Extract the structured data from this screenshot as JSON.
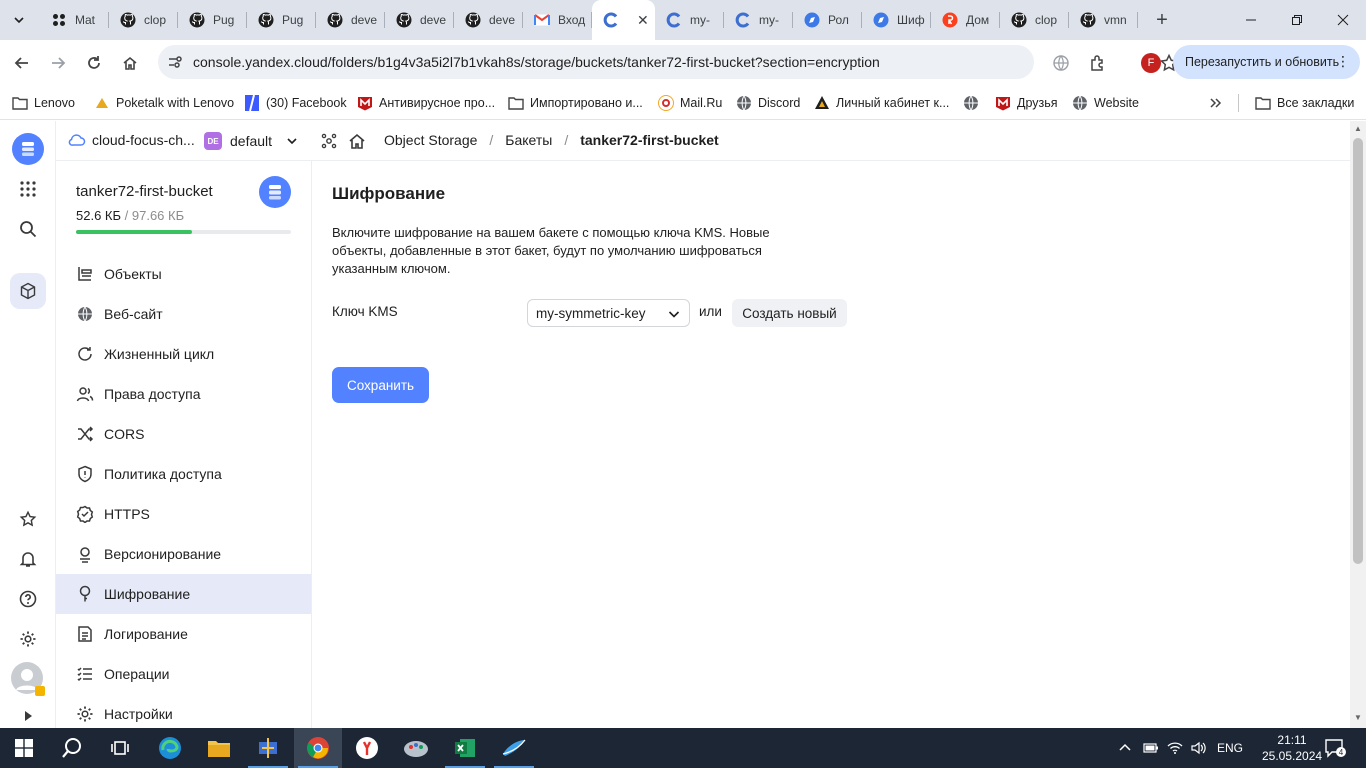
{
  "browser": {
    "tabs": [
      {
        "title": "Mat",
        "icon": "waffle-icon"
      },
      {
        "title": "clop",
        "icon": "github-icon"
      },
      {
        "title": "Pug",
        "icon": "github-icon"
      },
      {
        "title": "Pug",
        "icon": "github-icon"
      },
      {
        "title": "deve",
        "icon": "github-icon"
      },
      {
        "title": "deve",
        "icon": "github-icon"
      },
      {
        "title": "deve",
        "icon": "github-icon"
      },
      {
        "title": "Вход",
        "icon": "gmail-icon"
      },
      {
        "title": "",
        "icon": "yandex-cloud-icon",
        "active": true
      },
      {
        "title": "my-",
        "icon": "yandex-cloud-icon"
      },
      {
        "title": "my-",
        "icon": "yandex-cloud-icon"
      },
      {
        "title": "Рол",
        "icon": "compass-icon"
      },
      {
        "title": "Шиф",
        "icon": "compass-icon"
      },
      {
        "title": "Дом",
        "icon": "yandex-icon"
      },
      {
        "title": "clop",
        "icon": "github-icon"
      },
      {
        "title": "vmn",
        "icon": "github-icon"
      }
    ],
    "url": "console.yandex.cloud/folders/b1g4v3a5i2l7b1vkah8s/storage/buckets/tanker72-first-bucket?section=encryption",
    "relaunch_label": "Перезапустить и обновить",
    "profile_initial": "F",
    "bookmarks": [
      {
        "label": "Lenovo",
        "icon": "folder-icon"
      },
      {
        "label": "Poketalk with Lenovo",
        "icon": "poketalk-icon"
      },
      {
        "label": "(30) Facebook",
        "icon": "facebook-icon"
      },
      {
        "label": "Антивирусное про...",
        "icon": "mcafee-icon"
      },
      {
        "label": "Импортировано и...",
        "icon": "folder-icon"
      },
      {
        "label": "Mail.Ru",
        "icon": "mailru-icon"
      },
      {
        "label": "Discord",
        "icon": "globe-icon"
      },
      {
        "label": "Личный кабинет к...",
        "icon": "cabinet-icon"
      },
      {
        "label": "",
        "icon": "globe-icon"
      },
      {
        "label": "Друзья",
        "icon": "mcafee-icon"
      },
      {
        "label": "Website",
        "icon": "globe-icon"
      }
    ],
    "all_bookmarks_label": "Все закладки"
  },
  "header": {
    "cloud": "cloud-focus-ch...",
    "folder_badge": "DE",
    "folder": "default",
    "breadcrumb": [
      "Object Storage",
      "Бакеты",
      "tanker72-first-bucket"
    ]
  },
  "bucket": {
    "name": "tanker72-first-bucket",
    "used": "52.6 КБ",
    "total": " / 97.66 КБ",
    "usage_fraction": 0.54
  },
  "menu": [
    {
      "label": "Объекты",
      "icon": "objects-icon"
    },
    {
      "label": "Веб-сайт",
      "icon": "globe-icon"
    },
    {
      "label": "Жизненный цикл",
      "icon": "lifecycle-icon"
    },
    {
      "label": "Права доступа",
      "icon": "users-icon"
    },
    {
      "label": "CORS",
      "icon": "shuffle-icon"
    },
    {
      "label": "Политика доступа",
      "icon": "shield-icon"
    },
    {
      "label": "HTTPS",
      "icon": "check-badge-icon"
    },
    {
      "label": "Версионирование",
      "icon": "versions-icon"
    },
    {
      "label": "Шифрование",
      "icon": "key-icon",
      "selected": true
    },
    {
      "label": "Логирование",
      "icon": "log-icon"
    },
    {
      "label": "Операции",
      "icon": "list-icon"
    },
    {
      "label": "Настройки",
      "icon": "gear-icon"
    }
  ],
  "main": {
    "title": "Шифрование",
    "description": "Включите шифрование на вашем бакете с помощью ключа KMS. Новые объекты, добавленные в этот бакет, будут по умолчанию шифроваться указанным ключом.",
    "kms_label": "Ключ KMS",
    "kms_value": "my-symmetric-key",
    "or": "или",
    "create_label": "Создать новый",
    "save_label": "Сохранить"
  },
  "taskbar": {
    "lang": "ENG",
    "time": "21:11",
    "date": "25.05.2024",
    "notifications": "4"
  },
  "colors": {
    "accent": "#5282ff",
    "selected_bg": "#e5e9f8",
    "usage": "#3bc260"
  }
}
